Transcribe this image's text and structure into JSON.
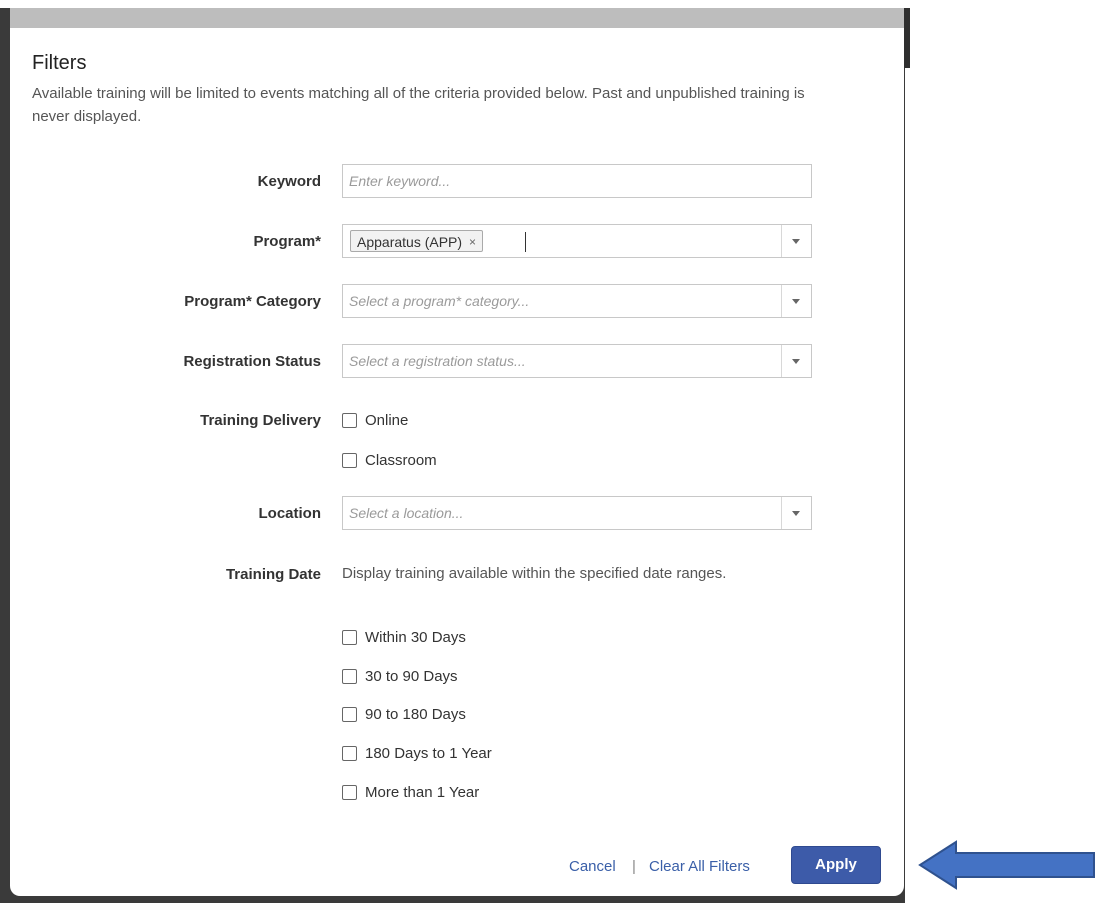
{
  "modal": {
    "title": "Filters",
    "description": "Available training will be limited to events matching all of the criteria provided below. Past and unpublished training is never displayed."
  },
  "fields": {
    "keyword": {
      "label": "Keyword",
      "placeholder": "Enter keyword..."
    },
    "program": {
      "label": "Program*",
      "selected_tag": "Apparatus (APP)",
      "remove_glyph": "×"
    },
    "program_category": {
      "label": "Program* Category",
      "placeholder": "Select a program* category..."
    },
    "registration_status": {
      "label": "Registration Status",
      "placeholder": "Select a registration status..."
    },
    "training_delivery": {
      "label": "Training Delivery",
      "options": [
        "Online",
        "Classroom"
      ]
    },
    "location": {
      "label": "Location",
      "placeholder": "Select a location..."
    },
    "training_date": {
      "label": "Training Date",
      "help": "Display training available within the specified date ranges.",
      "options": [
        "Within 30 Days",
        "30 to 90 Days",
        "90 to 180 Days",
        "180 Days to 1 Year",
        "More than 1 Year"
      ]
    }
  },
  "footer": {
    "cancel": "Cancel",
    "separator": "|",
    "clear_all": "Clear All Filters",
    "apply": "Apply"
  },
  "annotation": {
    "arrow_color": "#4472c4",
    "arrow_outline": "#2f528f"
  },
  "colors": {
    "primary_button": "#3d5ba9",
    "link": "#3a5fa8"
  }
}
